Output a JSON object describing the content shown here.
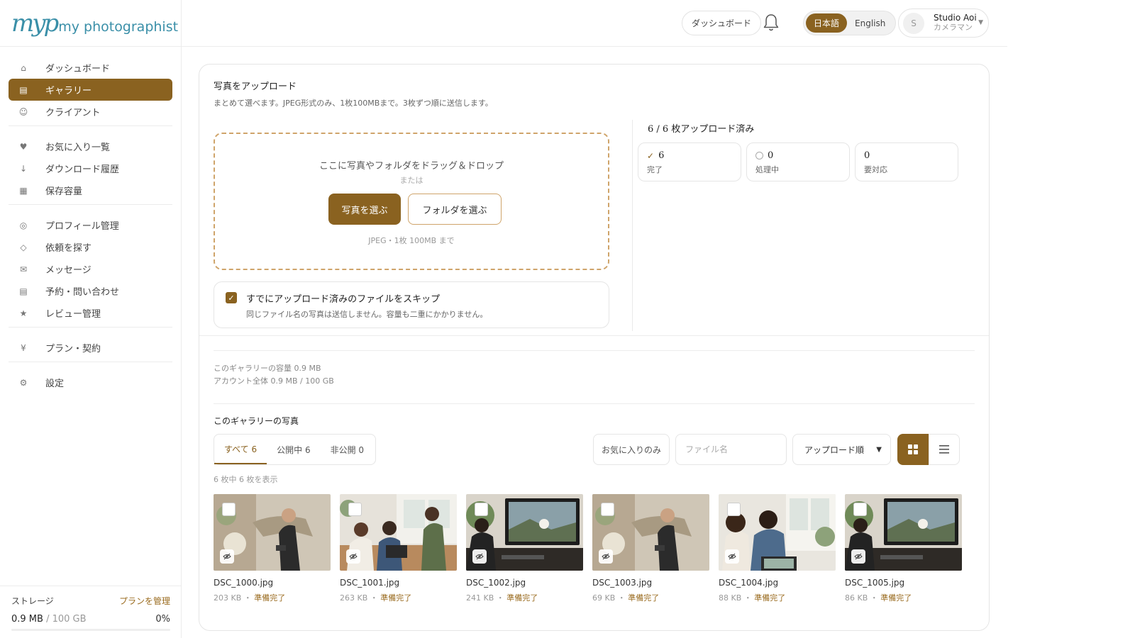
{
  "brand": {
    "mark": "myp",
    "name": "my photographist"
  },
  "sidebar": {
    "groups": [
      [
        {
          "label": "ダッシュボード",
          "icon": "⌂"
        },
        {
          "label": "ギャラリー",
          "icon": "▤"
        },
        {
          "label": "クライアント",
          "icon": "☺"
        }
      ],
      [
        {
          "label": "お気に入り一覧",
          "icon": "♥"
        },
        {
          "label": "ダウンロード履歴",
          "icon": "↓"
        },
        {
          "label": "保存容量",
          "icon": "▦"
        }
      ],
      [
        {
          "label": "プロフィール管理",
          "icon": "◎"
        },
        {
          "label": "依頼を探す",
          "icon": "◇"
        },
        {
          "label": "メッセージ",
          "icon": "✉"
        },
        {
          "label": "予約・問い合わせ",
          "icon": "▤"
        },
        {
          "label": "レビュー管理",
          "icon": "★"
        }
      ],
      [
        {
          "label": "プラン・契約",
          "icon": "¥"
        }
      ],
      [
        {
          "label": "設定",
          "icon": "⚙"
        }
      ]
    ],
    "active": "ギャラリー",
    "storage": {
      "label": "ストレージ",
      "manage": "プランを管理",
      "used": "0.9 MB",
      "total": " / 100 GB",
      "percent": "0%",
      "fraction": 0.0
    }
  },
  "header": {
    "dashboard": "ダッシュボード",
    "lang": {
      "ja": "日本語",
      "en": "English",
      "active": "ja"
    },
    "user": {
      "initial": "S",
      "name": "Studio Aoi",
      "role": "カメラマン"
    }
  },
  "upload": {
    "title": "写真をアップロード",
    "desc": "まとめて選べます。JPEG形式のみ、1枚100MBまで。3枚ずつ順に送信します。",
    "drop_main": "ここに写真やフォルダをドラッグ＆ドロップ",
    "drop_or": "または",
    "choose_photos": "写真を選ぶ",
    "choose_folder": "フォルダを選ぶ",
    "hint": "JPEG・1枚 100MB まで",
    "skip_title": "すでにアップロード済みのファイルをスキップ",
    "skip_desc": "同じファイル名の写真は送信しません。容量も二重にかかりません。",
    "skip_checked": true
  },
  "progress": {
    "title": "6 / 6 枚アップロード済み",
    "stats": [
      {
        "n": "6",
        "label": "完了",
        "mark": "✓"
      },
      {
        "n": "0",
        "label": "処理中",
        "mark": "circle"
      },
      {
        "n": "0",
        "label": "要対応",
        "mark": ""
      }
    ]
  },
  "capacity": {
    "gallery": "このギャラリーの容量 0.9 MB",
    "account": "アカウント全体 0.9 MB / 100 GB"
  },
  "gallery": {
    "title": "このギャラリーの写真",
    "tabs": [
      "すべて 6",
      "公開中 6",
      "非公開 0"
    ],
    "fav_only": "お気に入りのみ",
    "search_placeholder": "ファイル名",
    "sort": "アップロード順",
    "count": "6 枚中 6 枚を表示",
    "photos": [
      {
        "name": "DSC_1000.jpg",
        "size": "203 KB",
        "status": "準備完了",
        "scene": "man"
      },
      {
        "name": "DSC_1001.jpg",
        "size": "263 KB",
        "status": "準備完了",
        "scene": "group"
      },
      {
        "name": "DSC_1002.jpg",
        "size": "241 KB",
        "status": "準備完了",
        "scene": "monitor"
      },
      {
        "name": "DSC_1003.jpg",
        "size": "69 KB",
        "status": "準備完了",
        "scene": "man"
      },
      {
        "name": "DSC_1004.jpg",
        "size": "88 KB",
        "status": "準備完了",
        "scene": "couple"
      },
      {
        "name": "DSC_1005.jpg",
        "size": "86 KB",
        "status": "準備完了",
        "scene": "monitor"
      }
    ]
  },
  "colors": {
    "accent": "#8a6220",
    "logo": "#3a8fa8",
    "dash": "#cfa46a"
  }
}
